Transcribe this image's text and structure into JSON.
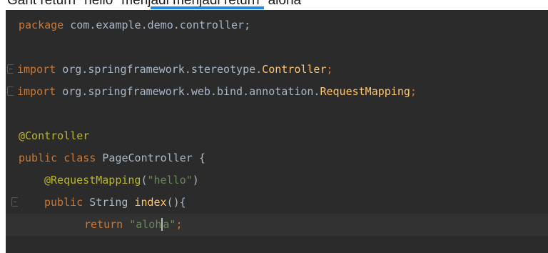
{
  "caption": "Gant return \"hello\" menjadi menjadi return \"aloha\"",
  "editor": {
    "lines": {
      "l1": {
        "kw": "package",
        "rest": " com.example.demo.controller;"
      },
      "l3": {
        "kw": "import",
        "pkg": " org.springframework.stereotype.",
        "cls": "Controller",
        "semi": ";"
      },
      "l4": {
        "kw": "import",
        "pkg": " org.springframework.web.bind.annotation.",
        "cls": "RequestMapping",
        "semi": ";"
      },
      "l6": {
        "ann": "@Controller"
      },
      "l7": {
        "kw1": "public",
        "kw2": "class",
        "name": "PageController",
        "brace": " {"
      },
      "l8": {
        "ann": "@RequestMapping",
        "open": "(",
        "str": "\"hello\"",
        "close": ")"
      },
      "l9": {
        "kw": "public",
        "type": "String",
        "method": "index",
        "sig": "(){"
      },
      "l10": {
        "kw": "return",
        "str_a": "\"aloh",
        "str_b": "a\"",
        "semi": ";"
      }
    }
  },
  "colors": {
    "background": "#2b2b2b",
    "keyword": "#cc7832",
    "annotation": "#bbb529",
    "string": "#6a8759",
    "plain": "#a9b7c6",
    "accent": "#1e88e5"
  }
}
